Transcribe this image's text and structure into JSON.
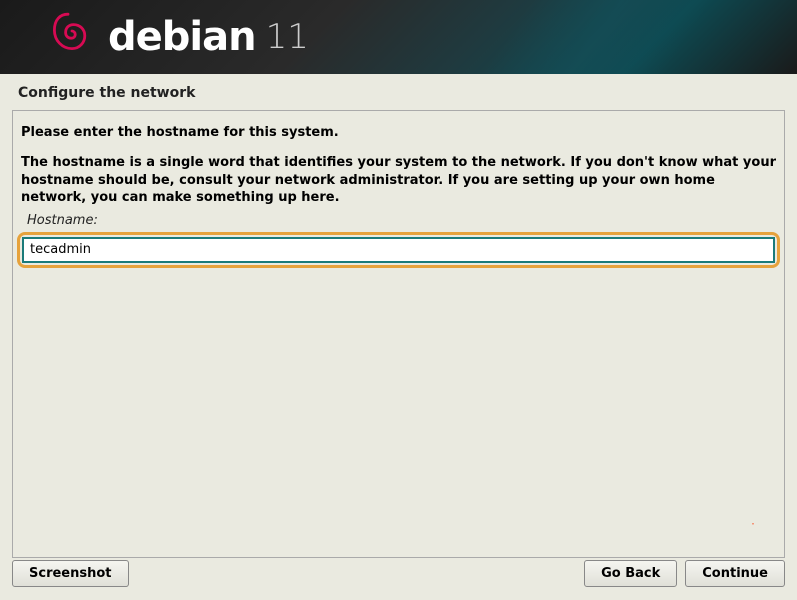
{
  "brand": {
    "name": "debian",
    "version": "11"
  },
  "page": {
    "title": "Configure the network"
  },
  "instructions": {
    "primary": "Please enter the hostname for this system.",
    "secondary": "The hostname is a single word that identifies your system to the network. If you don't know what your hostname should be, consult your network administrator. If you are setting up your own home network, you can make something up here."
  },
  "fields": {
    "hostname": {
      "label": "Hostname:",
      "value": "tecadmin"
    }
  },
  "buttons": {
    "screenshot": "Screenshot",
    "go_back": "Go Back",
    "continue": "Continue"
  }
}
